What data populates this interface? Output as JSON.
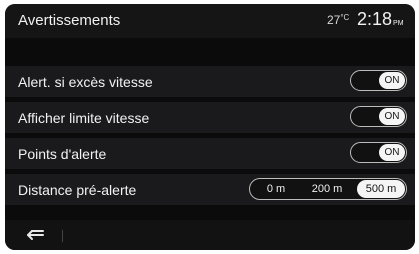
{
  "header": {
    "title": "Avertissements",
    "temperature": "27",
    "temperature_unit": "°C",
    "time": "2:18",
    "ampm": "PM"
  },
  "settings": [
    {
      "label": "Alert. si excès vitesse",
      "state": "ON"
    },
    {
      "label": "Afficher limite vitesse",
      "state": "ON"
    },
    {
      "label": "Points d'alerte",
      "state": "ON"
    }
  ],
  "distance_pre_alerte": {
    "label": "Distance pré-alerte",
    "options": [
      "0 m",
      "200 m",
      "500 m"
    ],
    "selected": "500 m"
  },
  "footer": {
    "back_icon": "back-arrow-icon"
  },
  "colors": {
    "screen_background": "#0b0b0c",
    "row_background": "#1a1a1c",
    "active_white": "#f5f5f5"
  }
}
